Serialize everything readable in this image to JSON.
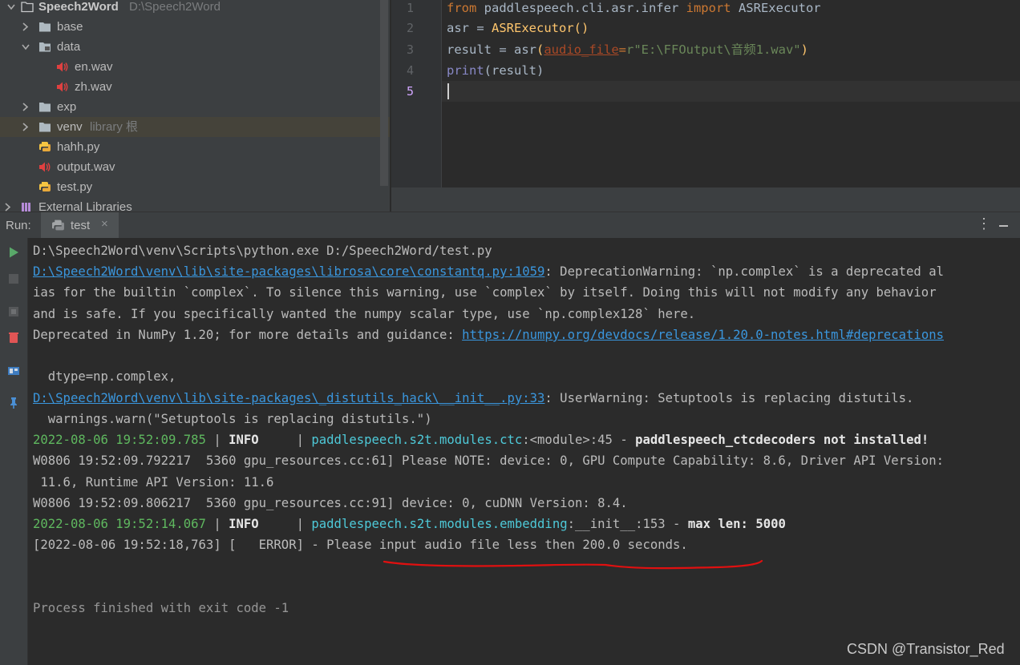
{
  "project_tree": {
    "root": {
      "name": "Speech2Word",
      "path": "D:\\Speech2Word"
    },
    "items": [
      {
        "label": "base",
        "hint": ""
      },
      {
        "label": "data",
        "hint": ""
      },
      {
        "label": "en.wav",
        "hint": ""
      },
      {
        "label": "zh.wav",
        "hint": ""
      },
      {
        "label": "exp",
        "hint": ""
      },
      {
        "label": "venv",
        "hint": "library 根"
      },
      {
        "label": "hahh.py",
        "hint": ""
      },
      {
        "label": "output.wav",
        "hint": ""
      },
      {
        "label": "test.py",
        "hint": ""
      },
      {
        "label": "External Libraries",
        "hint": ""
      }
    ]
  },
  "editor": {
    "line_numbers": [
      "1",
      "2",
      "3",
      "4",
      "5"
    ],
    "code": {
      "l1": {
        "kw1": "from",
        "mod": " paddlespeech.cli.asr.infer ",
        "kw2": "import",
        "name": " ASRExecutor"
      },
      "l2": {
        "lhs": "asr = ",
        "fn": "ASRExecutor",
        "paren": "()"
      },
      "l3": {
        "lhs": "result = asr",
        "p1": "(",
        "param": "audio_file",
        "eq": "=",
        "str": "r\"E:\\FFOutput\\音频1.wav\"",
        "p2": ")"
      },
      "l4": {
        "fn": "print",
        "args": "(result)"
      }
    }
  },
  "run_panel": {
    "label": "Run:",
    "tab": "test",
    "close": "×",
    "menu_icon": "⋮"
  },
  "console": {
    "lines": {
      "cmd": "D:\\Speech2Word\\venv\\Scripts\\python.exe D:/Speech2Word/test.py",
      "w1_link": "D:\\Speech2Word\\venv\\lib\\site-packages\\librosa\\core\\constantq.py:1059",
      "w1_text": ": DeprecationWarning: `np.complex` is a deprecated al",
      "w2": "ias for the builtin `complex`. To silence this warning, use `complex` by itself. Doing this will not modify any behavior",
      "w3": "and is safe. If you specifically wanted the numpy scalar type, use `np.complex128` here.",
      "w4_text": "Deprecated in NumPy 1.20; for more details and guidance: ",
      "w4_link": "https://numpy.org/devdocs/release/1.20.0-notes.html#deprecations",
      "dtype": "  dtype=np.complex,",
      "u1_link": "D:\\Speech2Word\\venv\\lib\\site-packages\\_distutils_hack\\__init__.py:33",
      "u1_text": ": UserWarning: Setuptools is replacing distutils.",
      "u2": "  warnings.warn(\"Setuptools is replacing distutils.\")",
      "i1_ts": "2022-08-06 19:52:09.785",
      "i1_sep1": " | ",
      "i1_level": "INFO",
      "i1_sep2": "     | ",
      "i1_mod": "paddlespeech.s2t.modules.ctc",
      "i1_func": ":<module>:45",
      "i1_dash": " - ",
      "i1_msg": "paddlespeech_ctcdecoders not installed!",
      "g1": "W0806 19:52:09.792217  5360 gpu_resources.cc:61] Please NOTE: device: 0, GPU Compute Capability: 8.6, Driver API Version:",
      "g2": " 11.6, Runtime API Version: 11.6",
      "g3": "W0806 19:52:09.806217  5360 gpu_resources.cc:91] device: 0, cuDNN Version: 8.4.",
      "i2_ts": "2022-08-06 19:52:14.067",
      "i2_sep1": " | ",
      "i2_level": "INFO",
      "i2_sep2": "     | ",
      "i2_mod": "paddlespeech.s2t.modules.embedding",
      "i2_func": ":__init__:153",
      "i2_dash": " - ",
      "i2_msg": "max len: 5000",
      "err": "[2022-08-06 19:52:18,763] [   ERROR] - Please input audio file less then 200.0 seconds.",
      "exit": "Process finished with exit code -1"
    }
  },
  "watermark": "CSDN @Transistor_Red",
  "colors": {
    "annotation": "#e01010",
    "link": "#3a96dd",
    "info_green": "#5fb85f"
  }
}
